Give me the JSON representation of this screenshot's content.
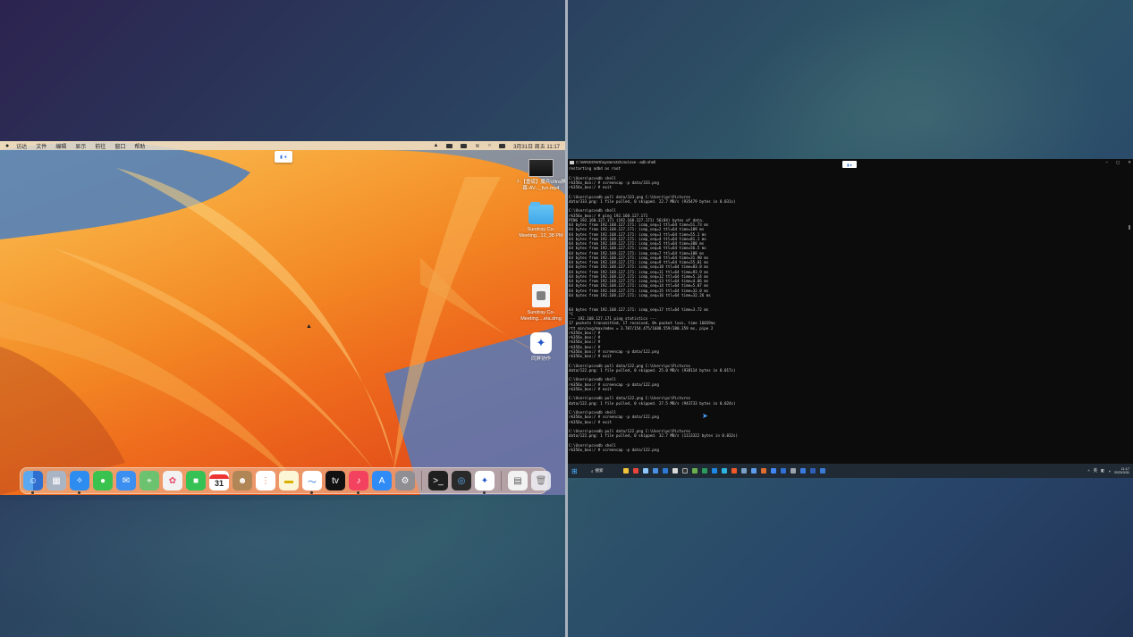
{
  "mac": {
    "menubar": {
      "apple": "",
      "items": [
        "访达",
        "文件",
        "编辑",
        "显示",
        "前往",
        "窗口",
        "帮助"
      ],
      "clock": "3月31日 周五 11:17"
    },
    "desktop_items": [
      {
        "name": "video-file",
        "label": "7-【重磅】魔兵Ultra屏幕-AV..._fun.mp4"
      },
      {
        "name": "folder",
        "label": "Sundray Co-Meeting...12_38 PM"
      },
      {
        "name": "dmg-file",
        "label": "Sundray Co-Meeting....eta.dmg"
      },
      {
        "name": "app",
        "label": "同屏协作"
      }
    ],
    "dock": {
      "calendar_day": "31",
      "calendar_month": "MAR",
      "apps": [
        "Finder",
        "Launchpad",
        "Safari",
        "Messages",
        "Mail",
        "Maps",
        "Photos",
        "FaceTime",
        "Calendar",
        "Contacts",
        "Reminders",
        "Notes",
        "Freeform",
        "TV",
        "Music",
        "App Store",
        "System Settings",
        "Terminal",
        "QuickTime",
        "同屏协作",
        "Preview",
        "Trash"
      ]
    }
  },
  "win": {
    "cmd_title": "C:\\WINDOWS\\system32\\cmd.exe - adb shell",
    "terminal_lines": [
      "restarting adbd as root",
      "",
      "C:\\Users\\pc>adb shell",
      "rk356x_box:/ # screencap -p data/333.png",
      "rk356x_box:/ # exit",
      "",
      "C:\\Users\\pc>adb pull data/333.png C:\\Users\\pc\\Pictures",
      "data/333.png: 1 file pulled, 0 skipped. 22.7 MB/s (935479 bytes in 0.031s)",
      "",
      "C:\\Users\\pc>adb shell",
      "rk356x_box:/ # ping 192.168.127.171",
      "PING 192.168.127.171 (192.168.127.171) 56(84) bytes of data.",
      "64 bytes from 192.168.127.171: icmp_seq=1 ttl=64 time=51.73 ms",
      "64 bytes from 192.168.127.171: icmp_seq=2 ttl=64 time=109 ms",
      "64 bytes from 192.168.127.171: icmp_seq=3 ttl=64 time=55.1 ms",
      "64 bytes from 192.168.127.171: icmp_seq=4 ttl=64 time=81.1 ms",
      "64 bytes from 192.168.127.171: icmp_seq=5 ttl=64 time=388 ms",
      "64 bytes from 192.168.127.171: icmp_seq=6 ttl=64 time=56.5 ms",
      "64 bytes from 192.168.127.171: icmp_seq=7 ttl=64 time=108 ms",
      "64 bytes from 192.168.127.171: icmp_seq=8 ttl=64 time=31.90 ms",
      "64 bytes from 192.168.127.171: icmp_seq=9 ttl=64 time=55.01 ms",
      "64 bytes from 192.168.127.171: icmp_seq=10 ttl=64 time=83.8 ms",
      "64 bytes from 192.168.127.171: icmp_seq=11 ttl=64 time=93.9 ms",
      "64 bytes from 192.168.127.171: icmp_seq=12 ttl=64 time=5.14 ms",
      "64 bytes from 192.168.127.171: icmp_seq=13 ttl=64 time=4.86 ms",
      "64 bytes from 192.168.127.171: icmp_seq=14 ttl=64 time=5.07 ms",
      "64 bytes from 192.168.127.171: icmp_seq=15 ttl=64 time=32.0 ms",
      "64 bytes from 192.168.127.171: icmp_seq=16 ttl=64 time=32.26 ms",
      "",
      "",
      "64 bytes from 192.168.127.171: icmp_seq=17 ttl=64 time=3.72 ms",
      "^C",
      "--- 192.168.127.171 ping statistics ---",
      "17 packets transmitted, 17 received, 0% packet loss, time 16039ms",
      "rtt min/avg/max/mdev = 3.707/154.475/1608.559/380.359 ms, pipe 2",
      "rk356x_box:/ #",
      "rk356x_box:/ #",
      "rk356x_box:/ #",
      "rk356x_box:/ #",
      "rk356x_box:/ # screencap -p data/122.png",
      "rk356x_box:/ # exit",
      "",
      "C:\\Users\\pc>adb pull data/122.png C:\\Users\\pc\\Pictures",
      "data/122.png: 1 file pulled, 0 skipped. 25.0 MB/s (938114 bytes in 0.017s)",
      "",
      "C:\\Users\\pc>adb shell",
      "rk356x_box:/ # screencap -p data/122.png",
      "rk356x_box:/ # exit",
      "",
      "C:\\Users\\pc>adb pull data/122.png C:\\Users\\pc\\Pictures",
      "data/122.png: 1 file pulled, 0 skipped. 27.5 MB/s (943733 bytes in 0.024s)",
      "",
      "C:\\Users\\pc>adb shell",
      "rk356x_box:/ # screencap -p data/122.png",
      "rk356x_box:/ # exit",
      "",
      "C:\\Users\\pc>adb pull data/122.png C:\\Users\\pc\\Pictures",
      "data/122.png: 1 file pulled, 0 skipped. 32.7 MB/s (1113322 bytes in 0.032s)",
      "",
      "C:\\Users\\pc>adb shell",
      "rk356x_box:/ # screencap -p data/122.png"
    ],
    "taskbar": {
      "search_label": "搜索",
      "time": "11:17",
      "date": "2023/3/31",
      "ime": "英"
    }
  }
}
